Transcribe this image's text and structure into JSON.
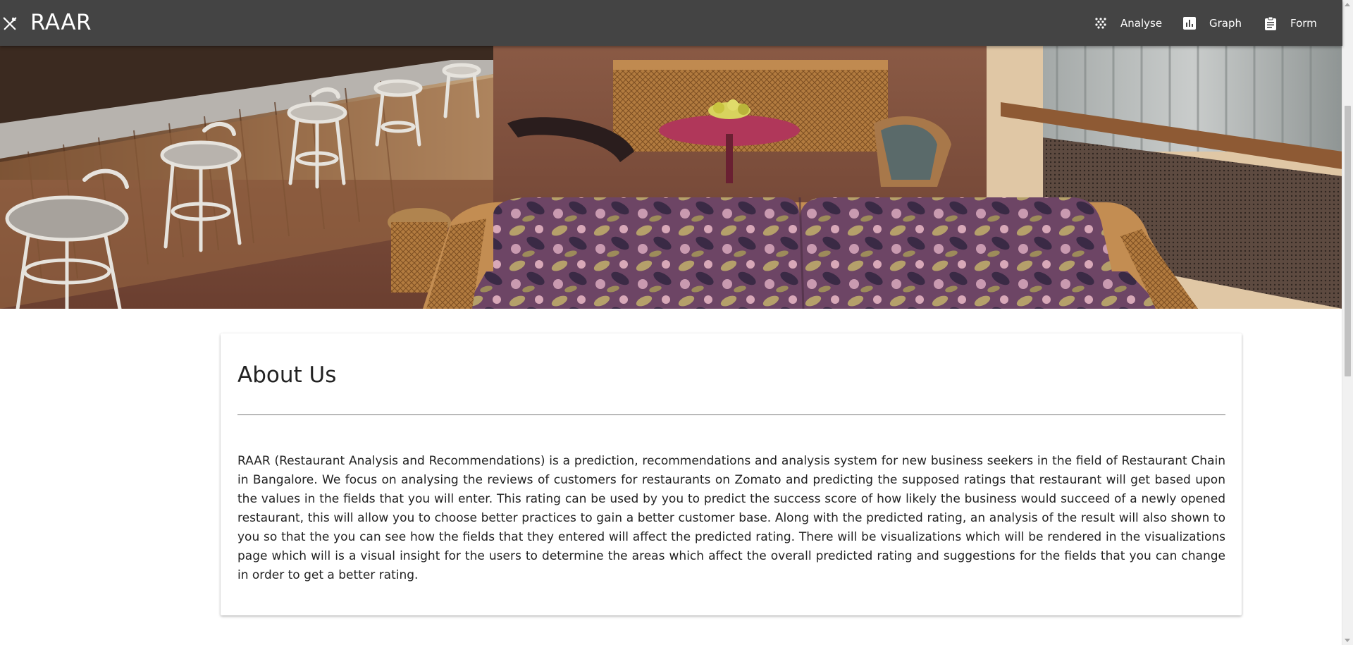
{
  "appbar": {
    "title": "RAAR",
    "brand_icon": "utensils-icon",
    "nav": [
      {
        "label": "Analyse",
        "icon": "scatter-icon"
      },
      {
        "label": "Graph",
        "icon": "bar-chart-icon"
      },
      {
        "label": "Form",
        "icon": "clipboard-icon"
      }
    ],
    "background_color": "#444444"
  },
  "hero": {
    "description_icon": "restaurant-photo"
  },
  "about": {
    "title": "About Us",
    "body": "RAAR (Restaurant Analysis and Recommendations) is a prediction, recommendations and analysis system for new business seekers in the field of Restaurant Chain in Bangalore. We focus on analysing the reviews of customers for restaurants on Zomato and predicting the supposed ratings that restaurant will get based upon the values in the fields that you will enter. This rating can be used by you to predict the success score of how likely the business would succeed of a newly opened restaurant, this will allow you to choose better practices to gain a better customer base. Along with the predicted rating, an analysis of the result will also shown to you so that the you can see how the fields that they entered will affect the predicted rating. There will be visualizations which will be rendered in the visualizations page which will is a visual insight for the users to determine the areas which affect the overall predicted rating and suggestions for the fields that you can change in order to get a better rating."
  }
}
